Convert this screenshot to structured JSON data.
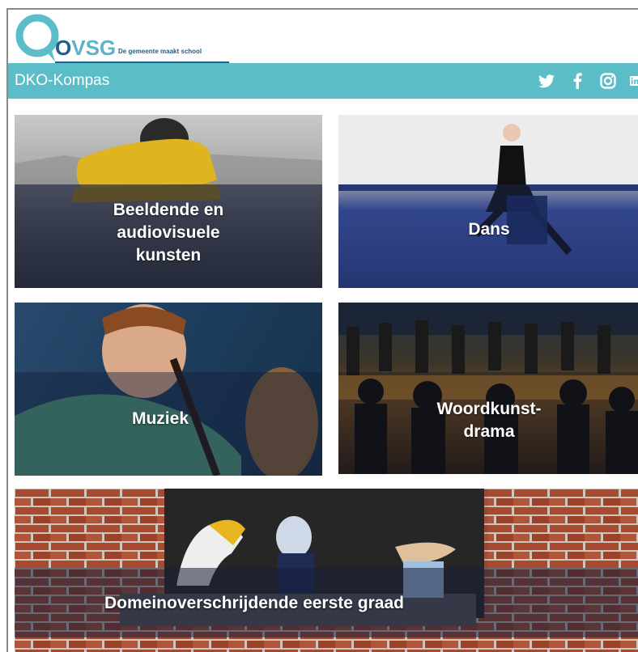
{
  "brand": {
    "logo_letters_o": "O",
    "logo_letters_vsg": "VSG",
    "tagline": "De gemeente maakt school",
    "accent": "#5bbdc8",
    "dark": "#1f5f8a"
  },
  "navbar": {
    "title": "DKO-Kompas",
    "social": [
      "twitter-icon",
      "facebook-icon",
      "instagram-icon",
      "linkedin-icon"
    ]
  },
  "tiles": [
    {
      "label_lines": [
        "Beeldende en",
        "audiovisuele",
        "kunsten"
      ]
    },
    {
      "label_lines": [
        "Dans"
      ]
    },
    {
      "label_lines": [
        "Muziek"
      ]
    },
    {
      "label_lines": [
        "Woordkunst-",
        "drama"
      ]
    },
    {
      "label_lines": [
        "Domeinoverschrijdende eerste graad"
      ]
    }
  ]
}
